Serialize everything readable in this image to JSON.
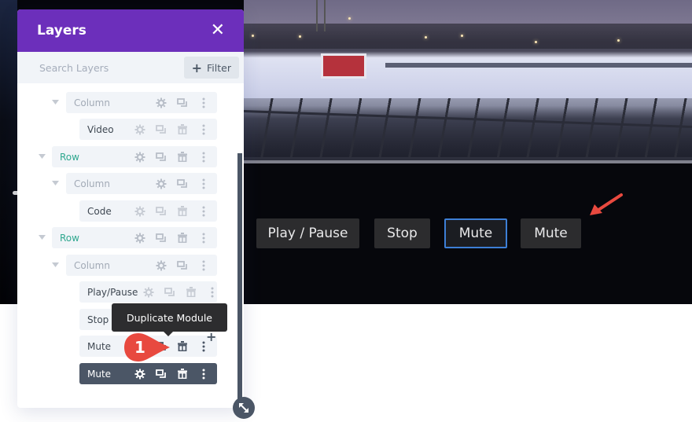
{
  "panel": {
    "title": "Layers",
    "close_icon": "close-icon",
    "search": {
      "placeholder": "Search Layers",
      "value": ""
    },
    "filter_label": "Filter"
  },
  "tree": [
    {
      "type": "column",
      "label": "Column",
      "expanded": true,
      "actions": [
        "settings",
        "duplicate",
        "more"
      ]
    },
    {
      "type": "module",
      "label": "Video",
      "actions": [
        "settings",
        "duplicate",
        "delete",
        "more"
      ]
    },
    {
      "type": "row",
      "label": "Row",
      "expanded": true,
      "actions": [
        "settings",
        "duplicate",
        "delete",
        "more"
      ]
    },
    {
      "type": "column",
      "label": "Column",
      "expanded": true,
      "actions": [
        "settings",
        "duplicate",
        "more"
      ]
    },
    {
      "type": "module",
      "label": "Code",
      "actions": [
        "settings",
        "duplicate",
        "delete",
        "more"
      ]
    },
    {
      "type": "row",
      "label": "Row",
      "expanded": true,
      "actions": [
        "settings",
        "duplicate",
        "delete",
        "more"
      ]
    },
    {
      "type": "column",
      "label": "Column",
      "expanded": true,
      "actions": [
        "settings",
        "duplicate",
        "more"
      ]
    },
    {
      "type": "module",
      "label": "Play/Pause",
      "actions": [
        "settings",
        "duplicate",
        "delete",
        "more"
      ]
    },
    {
      "type": "module",
      "label": "Stop",
      "actions": [
        "settings",
        "duplicate",
        "delete",
        "more"
      ]
    },
    {
      "type": "module",
      "label": "Mute",
      "hovered": true,
      "actions": [
        "settings",
        "duplicate",
        "delete",
        "more"
      ]
    },
    {
      "type": "module",
      "label": "Mute",
      "selected": true,
      "actions": [
        "settings",
        "duplicate",
        "delete",
        "more"
      ]
    }
  ],
  "tooltip": "Duplicate Module",
  "step_badge": "1",
  "add_module_label": "+",
  "video_controls": [
    {
      "label": "Play / Pause",
      "active": false
    },
    {
      "label": "Stop",
      "active": false
    },
    {
      "label": "Mute",
      "active": true
    },
    {
      "label": "Mute",
      "active": false
    }
  ],
  "colors": {
    "header": "#6c2fbb",
    "row_label": "#2fa88f",
    "selected_row": "#4b5666",
    "active_button_border": "#3d7fd6",
    "annotation_red": "#e8493f"
  }
}
